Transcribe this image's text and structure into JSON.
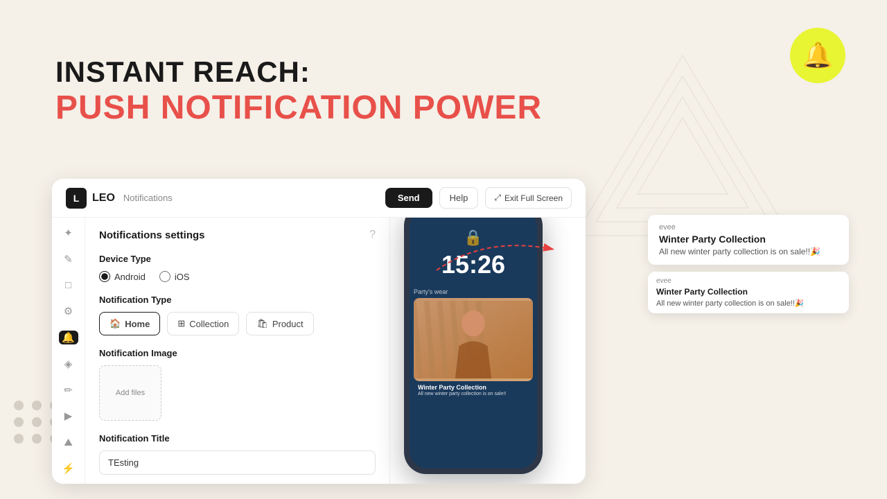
{
  "page": {
    "background_color": "#f5f0e8",
    "headline_line1": "INSTANT REACH:",
    "headline_line2": "PUSH NOTIFICATION POWER"
  },
  "bell": {
    "icon": "🔔",
    "bg_color": "#e8f532"
  },
  "card": {
    "logo_text": "LEO",
    "logo_subtitle": "Notifications",
    "btn_send": "Send",
    "btn_help": "Help",
    "btn_fullscreen": "Exit Full Screen"
  },
  "settings": {
    "title": "Notifications settings",
    "device_type_label": "Device Type",
    "android_label": "Android",
    "ios_label": "iOS",
    "android_selected": true,
    "notification_type_label": "Notification Type",
    "type_options": [
      {
        "id": "home",
        "label": "Home",
        "active": true
      },
      {
        "id": "collection",
        "label": "Collection",
        "active": false
      },
      {
        "id": "product",
        "label": "Product",
        "active": false
      }
    ],
    "notification_image_label": "Notification Image",
    "add_files_label": "Add files",
    "notification_title_label": "Notification Title",
    "notification_title_value": "TEsting"
  },
  "phone": {
    "time": "15:26",
    "collection_label": "Party's wear",
    "product_name": "Winter Party Collection",
    "product_desc": "All new winter party collection is on sale!!"
  },
  "notifications": [
    {
      "app": "evee",
      "title": "Winter Party Collection",
      "body": "All new winter party collection is on sale!!🎉"
    },
    {
      "app": "evee",
      "title": "Winter Party Collection",
      "body": "All new winter party collection is on sale!!🎉"
    }
  ],
  "sidebar_icons": [
    "✦",
    "✎",
    "□",
    "⚙",
    "🔔",
    "◈",
    "✏",
    "▶",
    "⛰",
    "⚡"
  ]
}
